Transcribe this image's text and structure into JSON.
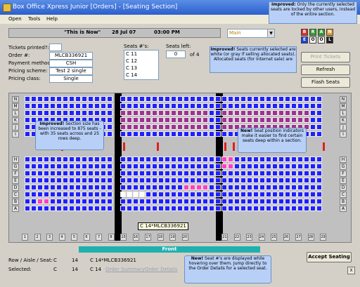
{
  "window": {
    "title": "Box Office Xpress Junior    [Orders] - [Seating Section]"
  },
  "menu": [
    "Open",
    "Tools",
    "Help"
  ],
  "infobar": {
    "event": "\"This is Now\"",
    "date": "28 Jul 07",
    "time": "03:00 PM"
  },
  "combo": {
    "value": "Main"
  },
  "price_buttons": [
    {
      "label": "B",
      "color": "#e03030"
    },
    {
      "label": "R",
      "color": "#30a030"
    },
    {
      "label": "A",
      "color": "#30a030"
    },
    {
      "label": "N",
      "color": "#e0a030"
    },
    {
      "label": "E",
      "color": "#2040e0"
    },
    {
      "label": "O",
      "color": "#ffffff"
    },
    {
      "label": "O",
      "color": "#ffffff"
    },
    {
      "label": "L",
      "color": "#202020"
    }
  ],
  "order": {
    "tickets_printed_label": "Tickets printed?:",
    "order_no_label": "Order #:",
    "order_no": "MLCB336921",
    "payment_label": "Payment method:",
    "payment": "CSH",
    "pricing_scheme_label": "Pricing scheme:",
    "pricing_scheme": "Test 2 single",
    "pricing_class_label": "Pricing class:",
    "pricing_class": "Single"
  },
  "seats": {
    "label": "Seats #'s:",
    "list": [
      "C 11",
      "C 12",
      "C 13",
      "C 14"
    ]
  },
  "seats_left": {
    "label": "Seats left:",
    "value": "0",
    "of_text": "of 4"
  },
  "buttons": {
    "print": "Print Tickets",
    "refresh": "Refresh",
    "flash": "Flash Seats",
    "accept": "Accept Seating"
  },
  "callouts": {
    "top_right": {
      "bold": "Improved:",
      "text": " Only the currently selected seats are locked by other users, instead of the entire section."
    },
    "middle": {
      "bold": "Improved!",
      "text": " Seats currently selected are white (or gray if selling allocated seats). Allocated seats (for Internet sale) are"
    },
    "section": {
      "bold": "Improved!",
      "text": " Section size has been increased to 875 seats - with 35 seats across and 25 rows deep."
    },
    "position": {
      "bold": "New!",
      "text": " Seat position indicators make it easier to find certain seats deep within a section."
    },
    "bottom": {
      "bold": "New!",
      "text": " Seat #'s are displayed while hovering over them. Jump directly to the Order Details for a selected seat."
    }
  },
  "rows_top": [
    "N",
    "M",
    "L",
    "K",
    "J",
    "I"
  ],
  "rows_bottom": [
    "H",
    "G",
    "F",
    "E",
    "D",
    "C",
    "B",
    "A"
  ],
  "columns": [
    "1",
    "2",
    "3",
    "4",
    "5",
    "6",
    "7",
    "8",
    "9",
    "10",
    "11",
    "12",
    "13",
    "14",
    "15",
    "16",
    "17",
    "18",
    "19",
    "20",
    "21",
    "22",
    "23",
    "24",
    "25",
    "26",
    "27",
    "28",
    "29"
  ],
  "tooltip": "C 14*MLCB336921",
  "front_label": "Front",
  "footer": {
    "ras_label": "Row / Aisle / Seat:",
    "ras_row": "C",
    "ras_seat": "14",
    "ras_info": "C 14*MLCB336921",
    "selected_label": "Selected:",
    "sel_row": "C",
    "sel_seat": "14",
    "sel_info": "C 14",
    "order_summary": "Order Summary",
    "order_details": "Order Details"
  },
  "close_glyph": "X"
}
